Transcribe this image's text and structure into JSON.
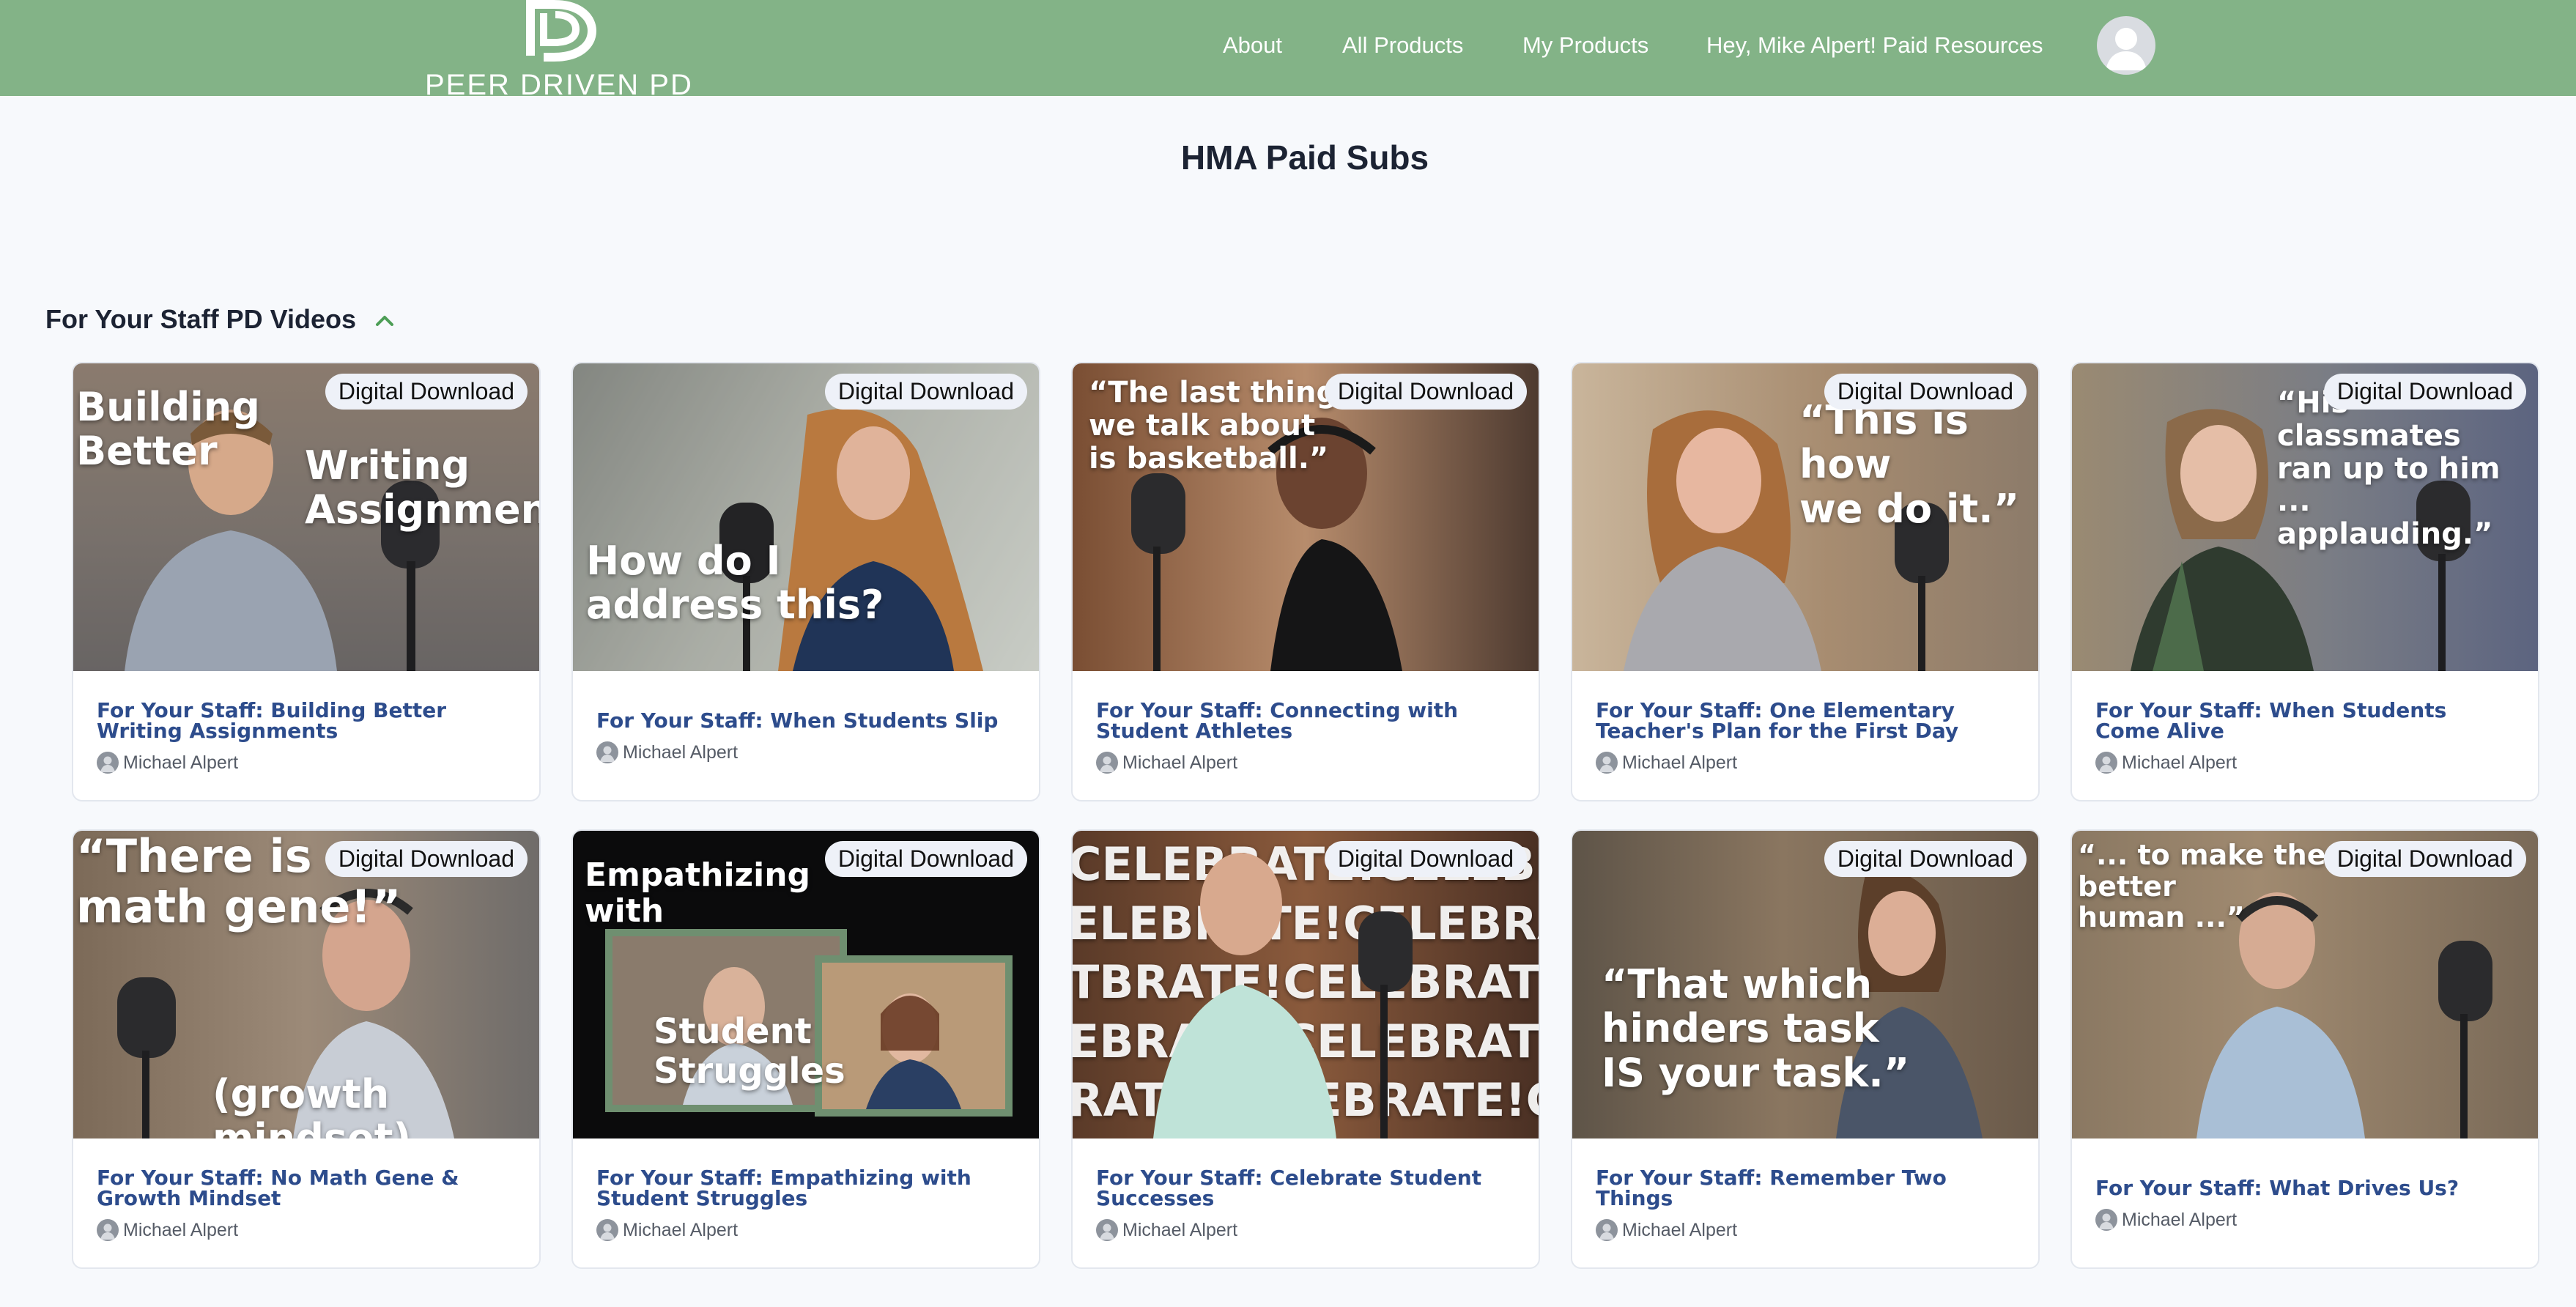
{
  "header": {
    "logo_text": "PEER DRIVEN PD",
    "nav": [
      "About",
      "All Products",
      "My Products",
      "Hey, Mike Alpert! Paid Resources"
    ],
    "colors": {
      "bar": "#83b387"
    }
  },
  "page": {
    "title": "HMA Paid Subs"
  },
  "section": {
    "title": "For Your Staff PD Videos",
    "icon": "chevron-up-icon"
  },
  "badge_label": "Digital Download",
  "cards": [
    {
      "title": "For Your Staff: Building Better Writing Assignments",
      "author": "Michael Alpert",
      "overlay": [
        "Building\n Better",
        "Writing\nAssignments"
      ]
    },
    {
      "title": "For Your Staff: When Students Slip",
      "author": "Michael Alpert",
      "overlay": [
        "How do I\naddress this?"
      ]
    },
    {
      "title": "For Your Staff: Connecting with Student Athletes",
      "author": "Michael Alpert",
      "overlay": [
        "“The last thing\nwe talk about\nis basketball.”"
      ]
    },
    {
      "title": "For Your Staff: One Elementary Teacher's Plan for the First Day",
      "author": "Michael Alpert",
      "overlay": [
        "“This is how\nwe do it.”"
      ]
    },
    {
      "title": "For Your Staff: When Students Come Alive",
      "author": "Michael Alpert",
      "overlay": [
        "“His classmates\nran up to him ...\napplauding.”"
      ]
    },
    {
      "title": "For Your Staff: No Math Gene & Growth Mindset",
      "author": "Michael Alpert",
      "overlay": [
        "“There is no\nmath gene!”",
        "(growth mindset)"
      ]
    },
    {
      "title": "For Your Staff: Empathizing with Student Struggles",
      "author": "Michael Alpert",
      "overlay": [
        "Empathizing\n   with",
        "Student\n   Struggles"
      ]
    },
    {
      "title": "For Your Staff: Celebrate Student Successes",
      "author": "Michael Alpert",
      "overlay": [
        "CELEBRATE!CELEBRATE!\nELEBRATE!CELEBRATE!C\nTBRATE!CELEBRATE!CEL\nEBRATE!CELEBRATE!CELE\nRATE!CELEBRATE!CELEB"
      ]
    },
    {
      "title": "For Your Staff: Remember Two Things",
      "author": "Michael Alpert",
      "overlay": [
        "“That which\nhinders task\nIS your task.”"
      ]
    },
    {
      "title": "For Your Staff: What Drives Us?",
      "author": "Michael Alpert",
      "overlay": [
        "“... to make them\n       better\n        human ...”"
      ]
    }
  ]
}
